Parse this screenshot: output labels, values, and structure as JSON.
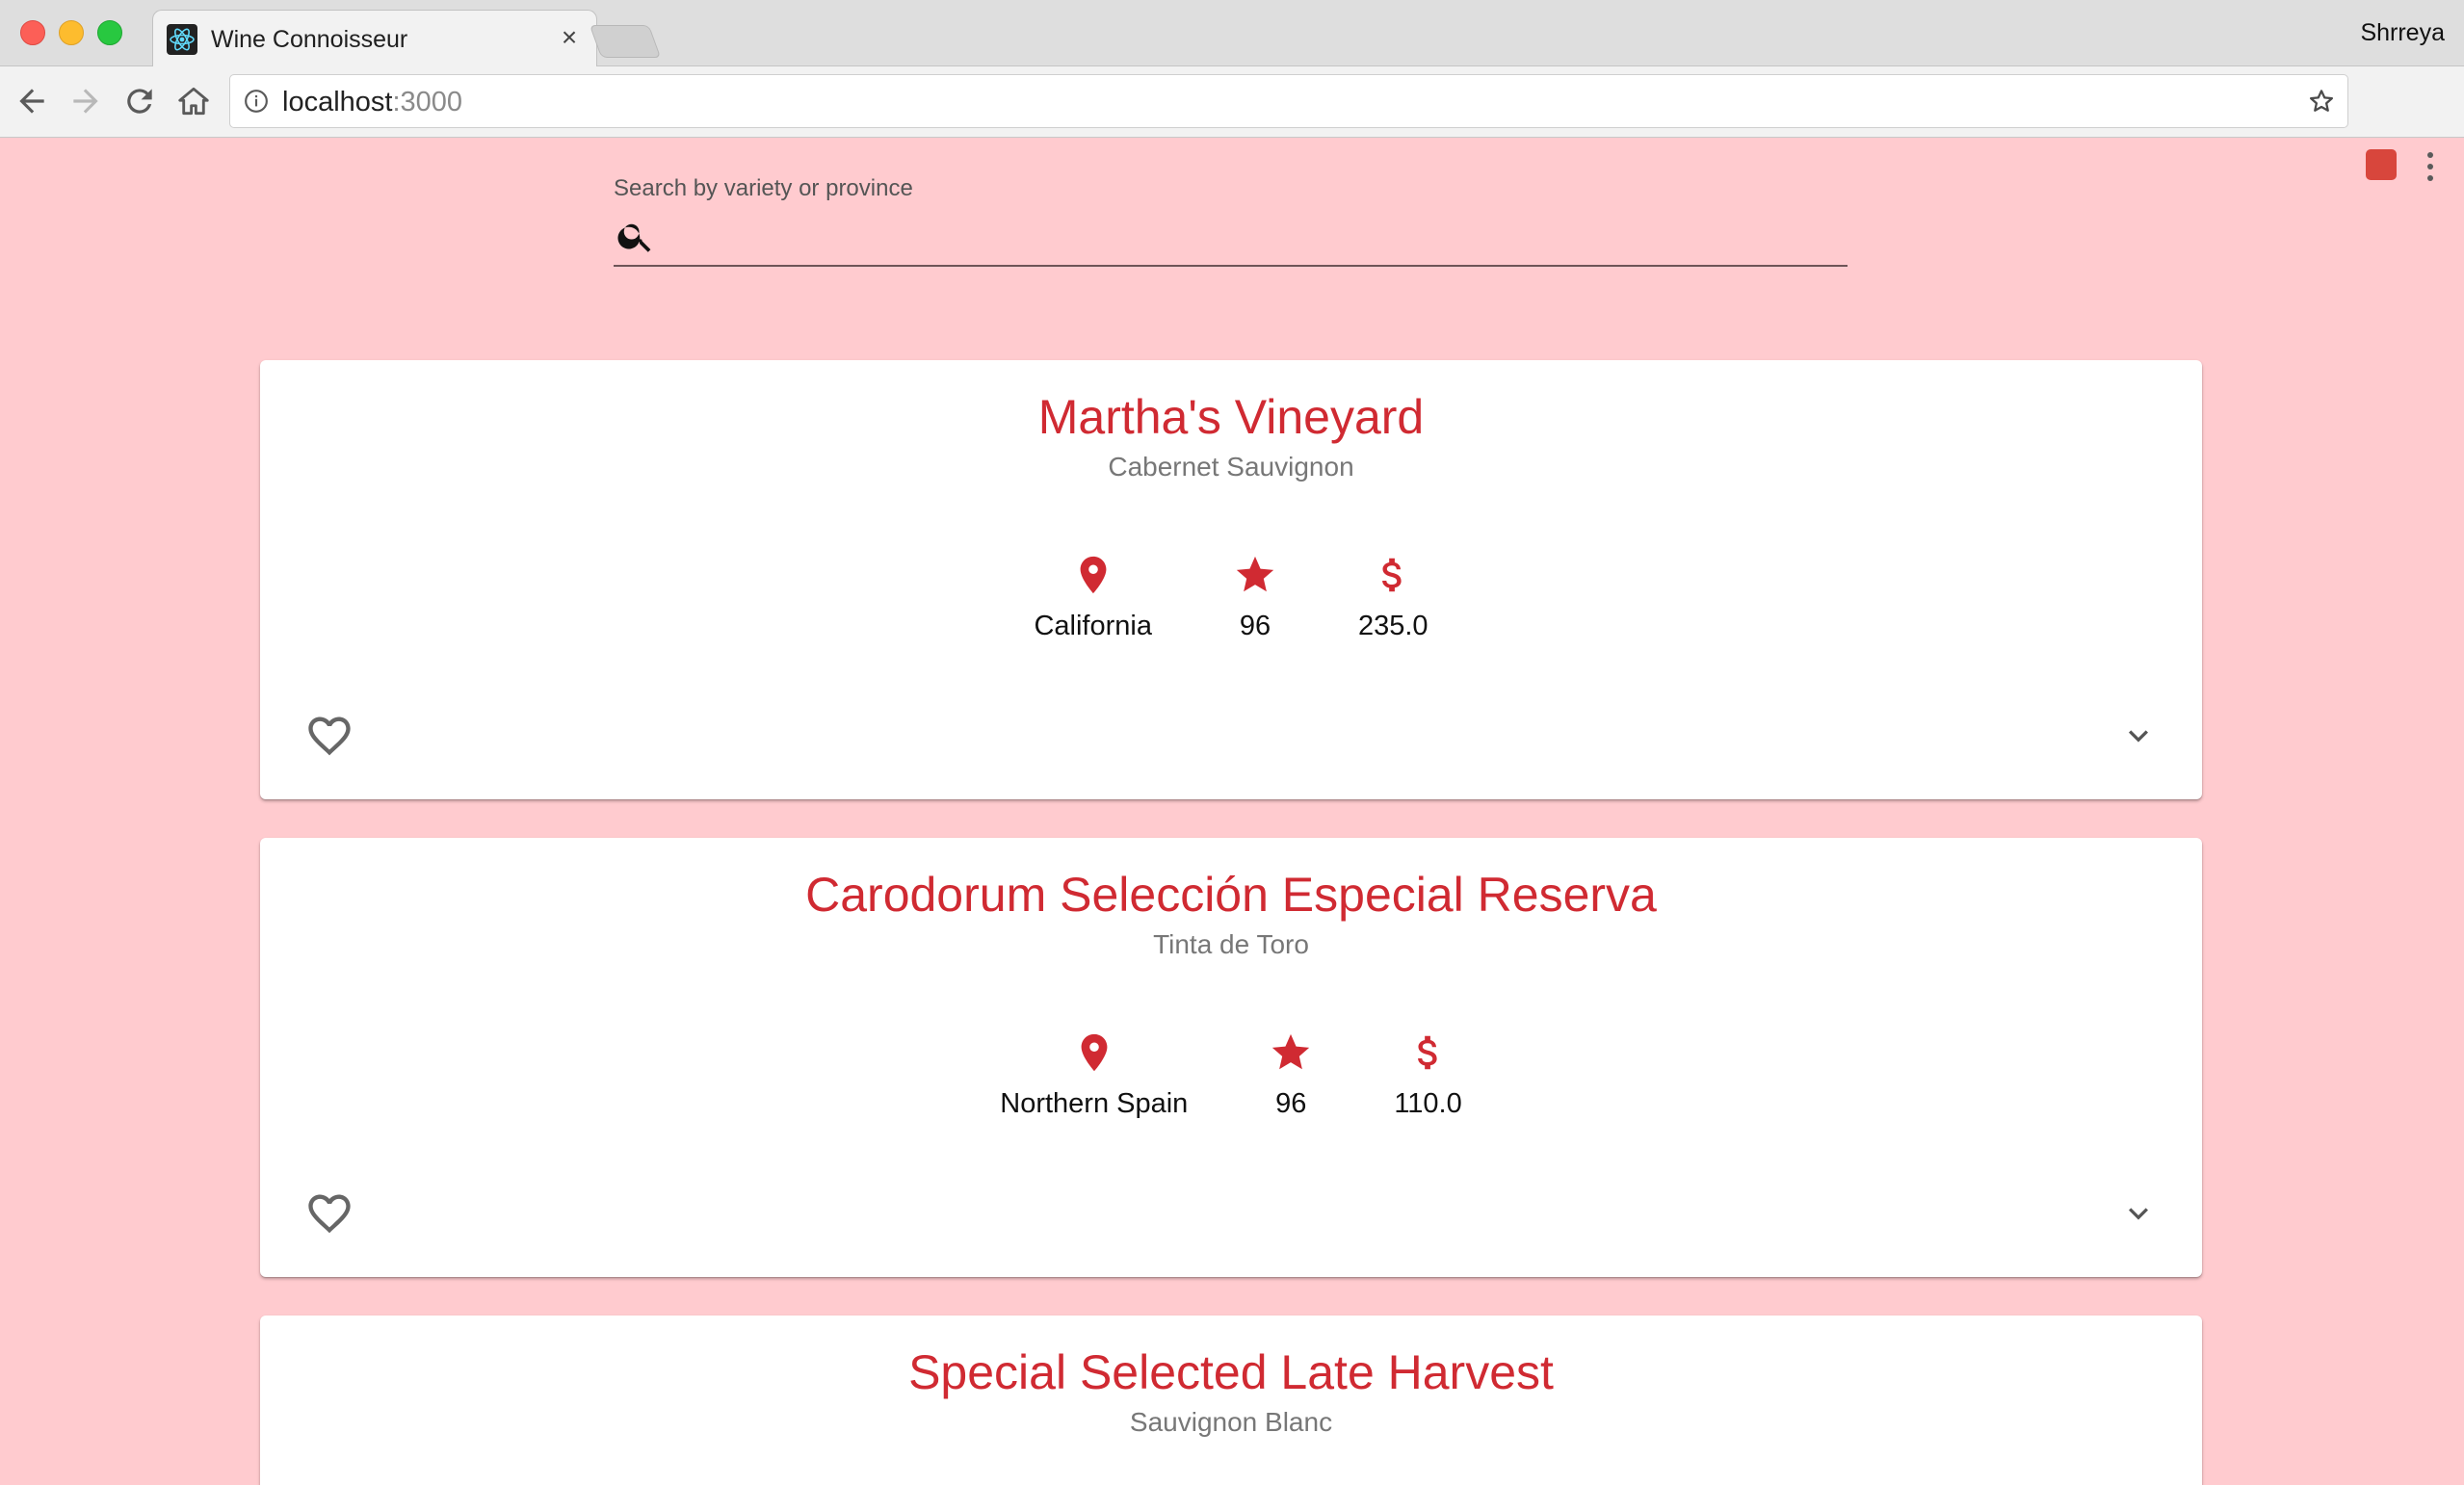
{
  "browser": {
    "tab_title": "Wine Connoisseur",
    "tab_close": "×",
    "profile_name": "Shrreya",
    "url_host": "localhost",
    "url_port": ":3000"
  },
  "search": {
    "label": "Search by variety or province",
    "value": ""
  },
  "colors": {
    "background": "#ffcbcf",
    "accent": "#d02a32"
  },
  "wines": [
    {
      "title": "Martha's Vineyard",
      "variety": "Cabernet Sauvignon",
      "province": "California",
      "points": "96",
      "price": "235.0"
    },
    {
      "title": "Carodorum Selección Especial Reserva",
      "variety": "Tinta de Toro",
      "province": "Northern Spain",
      "points": "96",
      "price": "110.0"
    },
    {
      "title": "Special Selected Late Harvest",
      "variety": "Sauvignon Blanc"
    }
  ]
}
